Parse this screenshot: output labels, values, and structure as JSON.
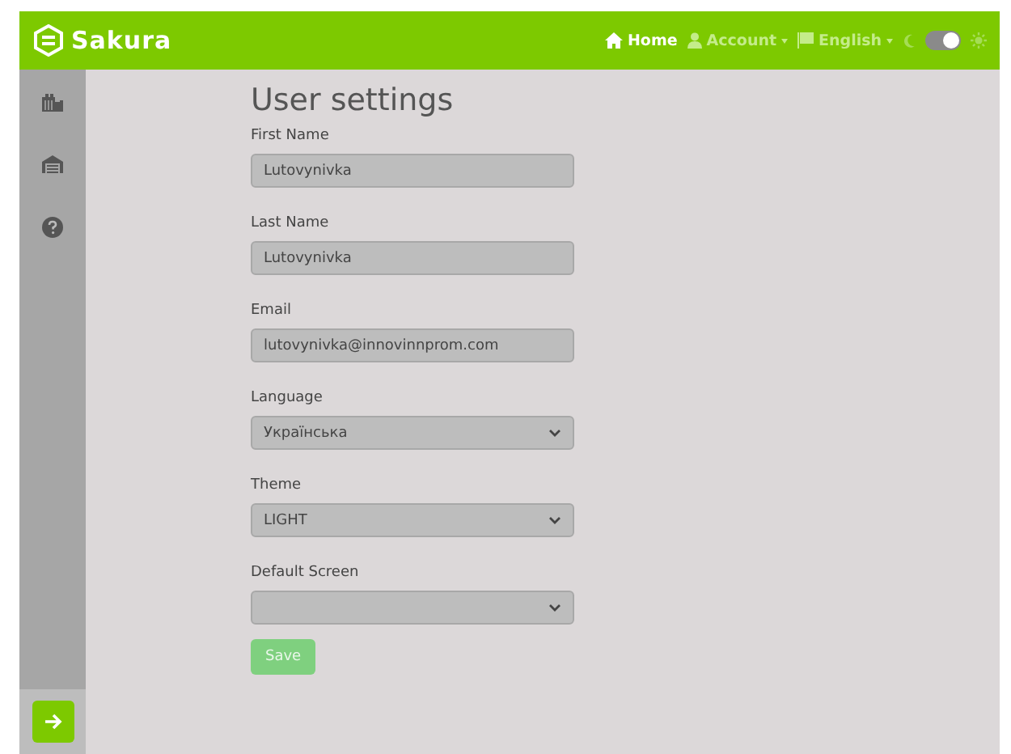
{
  "brand": {
    "name": "Sakura"
  },
  "nav": [
    {
      "kind": "home",
      "label": "Home",
      "selected": true,
      "dropdown": false
    },
    {
      "kind": "user",
      "label": "Account",
      "selected": false,
      "dropdown": true
    },
    {
      "kind": "flag",
      "label": "English",
      "selected": false,
      "dropdown": true
    }
  ],
  "light_mode": {
    "on": true
  },
  "sidebar": {
    "items": [
      {
        "kind": "factory"
      },
      {
        "kind": "warehouse"
      },
      {
        "kind": "help"
      }
    ]
  },
  "page": {
    "title": "User settings",
    "fields": [
      {
        "kind": "text",
        "label": "First Name",
        "value": "Lutovynivka"
      },
      {
        "kind": "text",
        "label": "Last Name",
        "value": "Lutovynivka"
      },
      {
        "kind": "text",
        "label": "Email",
        "value": "lutovynivka@innovinnprom.com"
      },
      {
        "kind": "select",
        "label": "Language",
        "value": "Українська"
      },
      {
        "kind": "select",
        "label": "Theme",
        "value": "LIGHT"
      },
      {
        "kind": "select",
        "label": "Default Screen"
      }
    ],
    "save": {
      "label": "Save",
      "disabled": true
    }
  }
}
